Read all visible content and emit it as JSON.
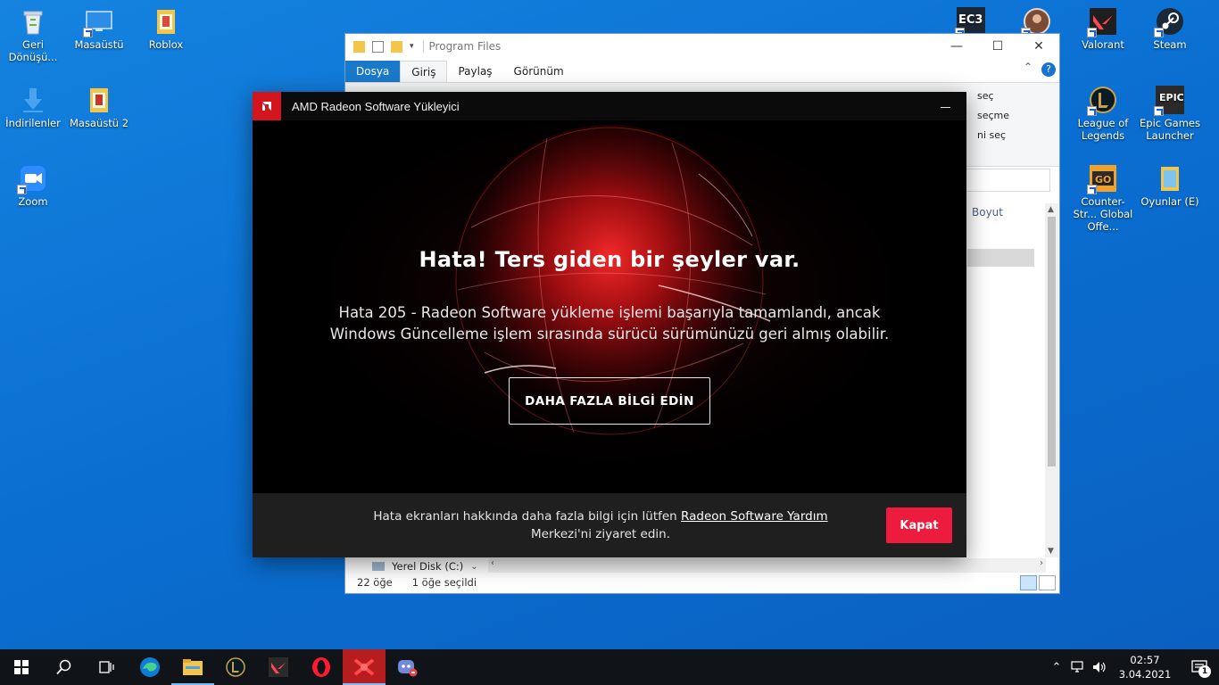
{
  "desktop": {
    "icons_left": [
      {
        "label": "Geri Dönüşü...",
        "icon": "recycle-bin-icon"
      },
      {
        "label": "Masaüstü",
        "icon": "desktop-shortcut-icon"
      },
      {
        "label": "Roblox",
        "icon": "folder-icon"
      },
      {
        "label": "İndirilenler",
        "icon": "downloads-icon"
      },
      {
        "label": "Masaüstü 2",
        "icon": "folder-icon"
      },
      {
        "label": "Zoom",
        "icon": "zoom-icon"
      }
    ],
    "icons_right": [
      {
        "label": "",
        "icon": "game-shortcut-icon"
      },
      {
        "label": "",
        "icon": "user-folder-icon"
      },
      {
        "label": "Valorant",
        "icon": "valorant-icon"
      },
      {
        "label": "Steam",
        "icon": "steam-icon"
      },
      {
        "label": "League of Legends",
        "icon": "league-of-legends-icon"
      },
      {
        "label": "Epic Games Launcher",
        "icon": "epic-games-icon"
      },
      {
        "label": "Counter-Str... Global Offe...",
        "icon": "csgo-icon"
      },
      {
        "label": "Oyunlar (E)",
        "icon": "drive-folder-icon"
      }
    ],
    "ec3_badge": "EC3",
    "epic_badge": "EPIC"
  },
  "explorer": {
    "title": "Program Files",
    "tabs": [
      "Dosya",
      "Giriş",
      "Paylaş",
      "Görünüm"
    ],
    "help": "?",
    "ribbon_fragments": [
      "seç",
      "seçme",
      "ni seç"
    ],
    "column_header": "Boyut",
    "nav_drive": "Yerel Disk (C:)",
    "status_items": "22 öğe",
    "status_selected": "1 öğe seçildi"
  },
  "amd": {
    "title": "AMD Radeon Software Yükleyici",
    "heading": "Hata! Ters giden bir şeyler var.",
    "message": "Hata 205 - Radeon Software yükleme işlemi başarıyla tamamlandı, ancak Windows Güncelleme işlem sırasında sürücü sürümünüzü geri almış olabilir.",
    "more_info_button": "DAHA FAZLA BİLGİ EDİN",
    "footer_prefix": "Hata ekranları hakkında daha fazla bilgi için lütfen ",
    "footer_link": "Radeon Software Yardım",
    "footer_suffix": " Merkezi'ni ziyaret edin.",
    "close_button": "Kapat",
    "colors": {
      "accent": "#ed1c3e",
      "logo": "#d4151d",
      "footer_bg": "#1f1f1f"
    }
  },
  "taskbar": {
    "apps": [
      "start-icon",
      "search-icon",
      "task-view-icon",
      "edge-icon",
      "file-explorer-icon",
      "league-of-legends-icon",
      "valorant-icon",
      "opera-icon",
      "amd-installer-icon",
      "discord-icon"
    ],
    "time": "02:57",
    "date": "3.04.2021",
    "notification_count": "1"
  }
}
